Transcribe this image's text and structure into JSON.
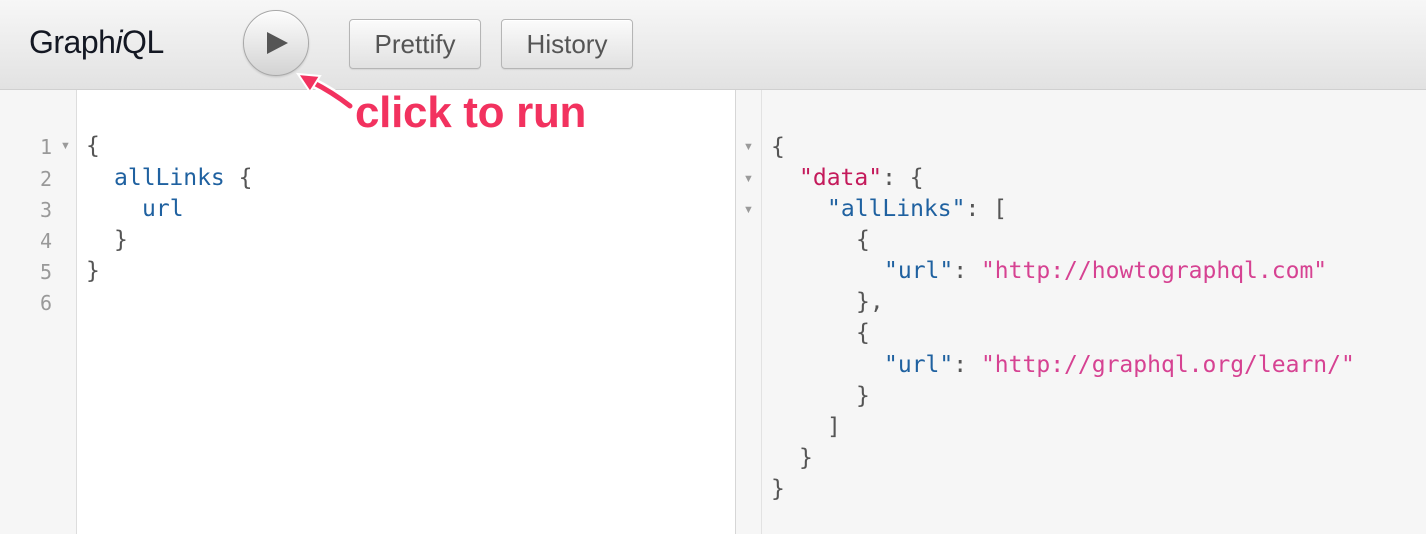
{
  "toolbar": {
    "title_prefix": "Graph",
    "title_em": "i",
    "title_suffix": "QL",
    "run_icon": "play-icon",
    "prettify_label": "Prettify",
    "history_label": "History"
  },
  "annotation": {
    "text": "click to run",
    "color": "#f2325f"
  },
  "query_editor": {
    "line_numbers": [
      "1",
      "2",
      "3",
      "4",
      "5",
      "6"
    ],
    "lines": {
      "l1": "{",
      "l2_field": "allLinks",
      "l2_brace": "{",
      "l3_field": "url",
      "l4": "}",
      "l5": "}"
    }
  },
  "result": {
    "lines": {
      "r1": "{",
      "r2_key": "\"data\"",
      "r2_rest": ": {",
      "r3_key": "\"allLinks\"",
      "r3_rest": ": [",
      "r4": "{",
      "r5_key": "\"url\"",
      "r5_colon": ": ",
      "r5_value": "\"http://howtographql.com\"",
      "r6": "},",
      "r7": "{",
      "r8_key": "\"url\"",
      "r8_colon": ": ",
      "r8_value": "\"http://graphql.org/learn/\"",
      "r9": "}",
      "r10": "]",
      "r11": "}",
      "r12": "}"
    }
  },
  "colors": {
    "field": "#1f61a0",
    "data_key": "#c41a5b",
    "string_value": "#d64292",
    "accent_annotation": "#f2325f"
  }
}
